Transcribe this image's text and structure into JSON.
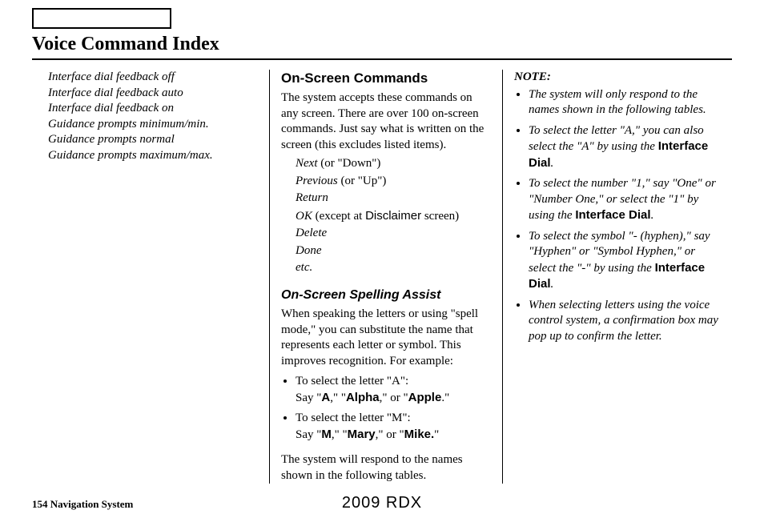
{
  "page_title": "Voice Command Index",
  "col1": {
    "lines": [
      "Interface dial feedback off",
      "Interface dial feedback auto",
      "Interface dial feedback on",
      "Guidance prompts minimum/min.",
      "Guidance prompts normal",
      "Guidance prompts maximum/max."
    ]
  },
  "col2": {
    "heading1": "On-Screen Commands",
    "intro1": "The system accepts these commands on any screen. There are over 100 on-screen commands. Just say what is written on the screen (this excludes listed items).",
    "cmds": {
      "next_i": "Next ",
      "next_r": "(or \"Down\")",
      "prev_i": "Previous ",
      "prev_r": "(or \"Up\")",
      "return": "Return",
      "ok_i": "OK ",
      "ok_r1": "(except at ",
      "ok_sans": "Disclaimer",
      "ok_r2": " screen)",
      "delete": "Delete",
      "done": "Done",
      "etc": "etc."
    },
    "heading2": "On-Screen Spelling Assist",
    "intro2": "When speaking the letters or using \"spell mode,\" you can substitute the name that represents each letter or symbol. This improves recognition. For example:",
    "bullet_a_1": "To select the letter \"A\":",
    "bullet_a_2a": "Say \"",
    "bullet_a_A": "A",
    "bullet_a_2b": ",\" \"",
    "bullet_a_Alpha": "Alpha",
    "bullet_a_2c": ",\" or \"",
    "bullet_a_Apple": "Apple",
    "bullet_a_2d": ".\"",
    "bullet_m_1": "To select the letter \"M\":",
    "bullet_m_2a": "Say \"",
    "bullet_m_M": "M",
    "bullet_m_2b": ",\" \"",
    "bullet_m_Mary": "Mary",
    "bullet_m_2c": ",\" or \"",
    "bullet_m_Mike": "Mike.",
    "bullet_m_2d": "\"",
    "outro": "The system will respond to the names shown in the following tables."
  },
  "col3": {
    "note_label": "NOTE:",
    "b1": "The system will only respond to the names shown in the following tables.",
    "b2a": "To select the letter \"A,\" you can also select the \"A\" by using the ",
    "b2_iface": "Interface Dial",
    "b2b": ".",
    "b3a": "To select the number \"1,\" say \"One\" or \"Number One,\" or select the \"1\" by using the ",
    "b3_iface": "Interface Dial",
    "b3b": ".",
    "b4a": "To select the symbol \"- (hyphen),\" say \"Hyphen\" or \"Symbol Hyphen,\" or select the \"-\" by using the ",
    "b4_iface": "Interface Dial",
    "b4b": ".",
    "b5": "When selecting letters using the voice control system, a confirmation box may pop up to confirm the letter."
  },
  "footer": {
    "page": "154",
    "label": " Navigation System",
    "center": "2009  RDX"
  }
}
